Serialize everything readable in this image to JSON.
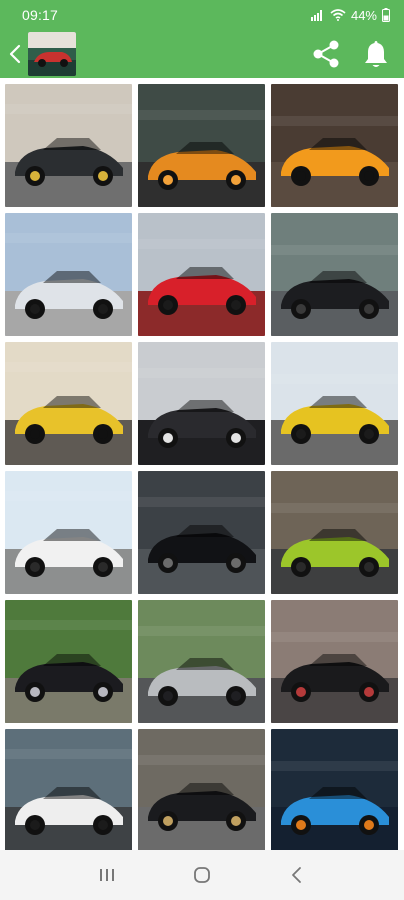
{
  "status_bar": {
    "time": "09:17",
    "battery": "44%",
    "icons": [
      "signal-icon",
      "wifi-icon",
      "battery-icon"
    ]
  },
  "app_bar": {
    "back_icon": "back-arrow-icon",
    "thumbnail": "car-thumbnail",
    "actions": [
      "share-icon",
      "bell-icon"
    ]
  },
  "gallery": {
    "items": [
      {
        "name": "black-supercar-doors-open",
        "sky": "#cfc8bd",
        "ground": "#6f6f6f",
        "car": "#2b2e31",
        "accent": "#d7b23a"
      },
      {
        "name": "orange-mclaren-wet-road",
        "sky": "#3f4b46",
        "ground": "#2f2f2f",
        "car": "#e58a1f",
        "accent": "#f3a23a"
      },
      {
        "name": "orange-mclaren-cobblestone",
        "sky": "#4a3c33",
        "ground": "#5a4b40",
        "car": "#f29a1c",
        "accent": "#111111"
      },
      {
        "name": "silver-mclaren-doors-up",
        "sky": "#a9bfd7",
        "ground": "#a7a7a7",
        "car": "#dfe3e8",
        "accent": "#1b1b1b"
      },
      {
        "name": "red-mclaren-reflection",
        "sky": "#b9c1c9",
        "ground": "#8c2a2a",
        "car": "#d8202a",
        "accent": "#1b1b1b"
      },
      {
        "name": "black-coupe-parking",
        "sky": "#6f7f7c",
        "ground": "#5a5e61",
        "car": "#1c1d20",
        "accent": "#3a3a3a"
      },
      {
        "name": "yellow-lamborghini-hotel",
        "sky": "#e3dac7",
        "ground": "#5f5a54",
        "car": "#e8c22a",
        "accent": "#111111"
      },
      {
        "name": "lamborghini-steering-wheel",
        "sky": "#c9ccd0",
        "ground": "#1f1f22",
        "car": "#2a2a2e",
        "accent": "#e3e3e3"
      },
      {
        "name": "yellow-urus-palms",
        "sky": "#dbe3ea",
        "ground": "#6a6a6a",
        "car": "#e6c321",
        "accent": "#1b1b1b"
      },
      {
        "name": "white-rolls-royce-palms",
        "sky": "#dbe8f2",
        "ground": "#8d8f8f",
        "car": "#f1f1f1",
        "accent": "#2a2a2a"
      },
      {
        "name": "black-urus-garage",
        "sky": "#3c4146",
        "ground": "#4f5458",
        "car": "#111215",
        "accent": "#6b6b6b"
      },
      {
        "name": "green-lamborghini-street",
        "sky": "#6e6457",
        "ground": "#3e3f40",
        "car": "#9cc62a",
        "accent": "#2a2a2a"
      },
      {
        "name": "black-rolls-royce-garden",
        "sky": "#4f7a3c",
        "ground": "#7a7a6a",
        "car": "#1b1b1f",
        "accent": "#b8b8c0"
      },
      {
        "name": "silver-rolls-royce-front",
        "sky": "#6d8a5c",
        "ground": "#545658",
        "car": "#b9bcbf",
        "accent": "#1f1f22"
      },
      {
        "name": "black-sportscar-storefront",
        "sky": "#8b7c75",
        "ground": "#4a4545",
        "car": "#1a1a1c",
        "accent": "#b53a3a"
      },
      {
        "name": "white-urus-garage",
        "sky": "#5d6f7a",
        "ground": "#3e4245",
        "car": "#eeeeee",
        "accent": "#1b1b1b"
      },
      {
        "name": "black-sedan-street",
        "sky": "#6e6a62",
        "ground": "#6b6b6b",
        "car": "#1a1b1e",
        "accent": "#c0a060"
      },
      {
        "name": "blue-lamborghini-closeup",
        "sky": "#1d2b3a",
        "ground": "#142030",
        "car": "#2a8fd8",
        "accent": "#e07a1a"
      }
    ]
  },
  "nav_bar": {
    "buttons": [
      "recents-icon",
      "home-icon",
      "back-icon"
    ]
  },
  "colors": {
    "app_bar": "#5cb85c",
    "nav_bar": "#f4f4f4"
  }
}
